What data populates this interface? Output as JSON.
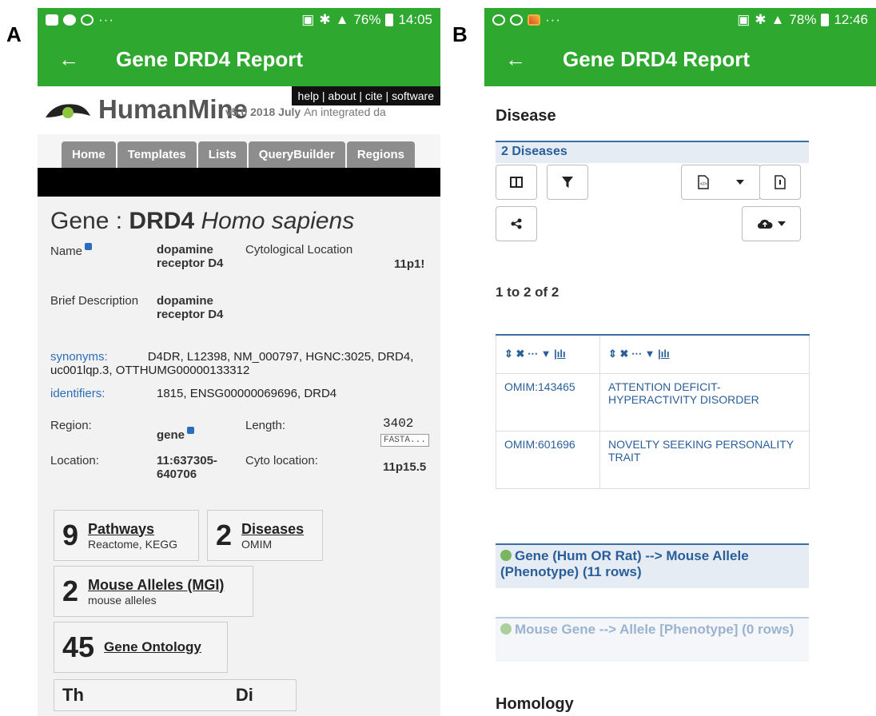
{
  "panels": {
    "a": "A",
    "b": "B"
  },
  "phone_a": {
    "status": {
      "dots": "···",
      "battery": "76%",
      "time": "14:05"
    },
    "appbar": {
      "back": "←",
      "title": "Gene DRD4 Report"
    },
    "humanmine": {
      "brand": "HumanMine",
      "version": "v5.0 2018 July",
      "tagline": "An integrated da",
      "links": "help | about | cite | software",
      "tabs": [
        "Home",
        "Templates",
        "Lists",
        "QueryBuilder",
        "Regions"
      ]
    },
    "gene": {
      "title_prefix": "Gene : ",
      "symbol": "DRD4",
      "organism": "Homo sapiens",
      "name_label": "Name",
      "name_value": "dopamine receptor D4",
      "cyto_label": "Cytological Location",
      "cyto_value": "11p1!",
      "brief_label": "Brief Description",
      "brief_value": "dopamine receptor D4",
      "synonyms_label": "synonyms:",
      "synonyms_value": "D4DR, L12398, NM_000797, HGNC:3025, DRD4, uc001lqp.3, OTTHUMG00000133312",
      "identifiers_label": "identifiers:",
      "identifiers_value": "1815, ENSG00000069696, DRD4",
      "region_label": "Region:",
      "region_value": "gene",
      "length_label": "Length:",
      "length_value": "3402",
      "fasta": "FASTA...",
      "location_label": "Location:",
      "location_value": "11:637305-640706",
      "cyto_loc_label": "Cyto location:",
      "cyto_loc_value": "11p15.5"
    },
    "summary_boxes": [
      {
        "count": "9",
        "title": "Pathways",
        "sub": "Reactome, KEGG"
      },
      {
        "count": "2",
        "title": "Diseases",
        "sub": "OMIM"
      },
      {
        "count": "2",
        "title": "Mouse Alleles (MGI)",
        "sub": "mouse alleles"
      },
      {
        "count": "45",
        "title": "Gene Ontology",
        "sub": ""
      }
    ],
    "partial_box": {
      "left": "Th",
      "right": "Di"
    }
  },
  "phone_b": {
    "status": {
      "dots": "···",
      "battery": "78%",
      "time": "12:46"
    },
    "appbar": {
      "back": "←",
      "title": "Gene DRD4 Report"
    },
    "disease_heading": "Disease",
    "diseases_bar": "2 Diseases",
    "range": "1 to 2 of 2",
    "table_rows": [
      {
        "id": "OMIM:143465",
        "name": "ATTENTION DEFICIT-HYPERACTIVITY DISORDER"
      },
      {
        "id": "OMIM:601696",
        "name": "NOVELTY SEEKING PERSONALITY TRAIT"
      }
    ],
    "template_1": "Gene (Hum OR Rat) --> Mouse Allele (Phenotype)   (11 rows)",
    "template_2": "Mouse Gene --> Allele [Phenotype]   (0 rows)",
    "homology_heading": "Homology"
  },
  "colors": {
    "appbar": "#2fa82f",
    "link": "#2a6ebb",
    "table_link": "#2a5e9a"
  }
}
